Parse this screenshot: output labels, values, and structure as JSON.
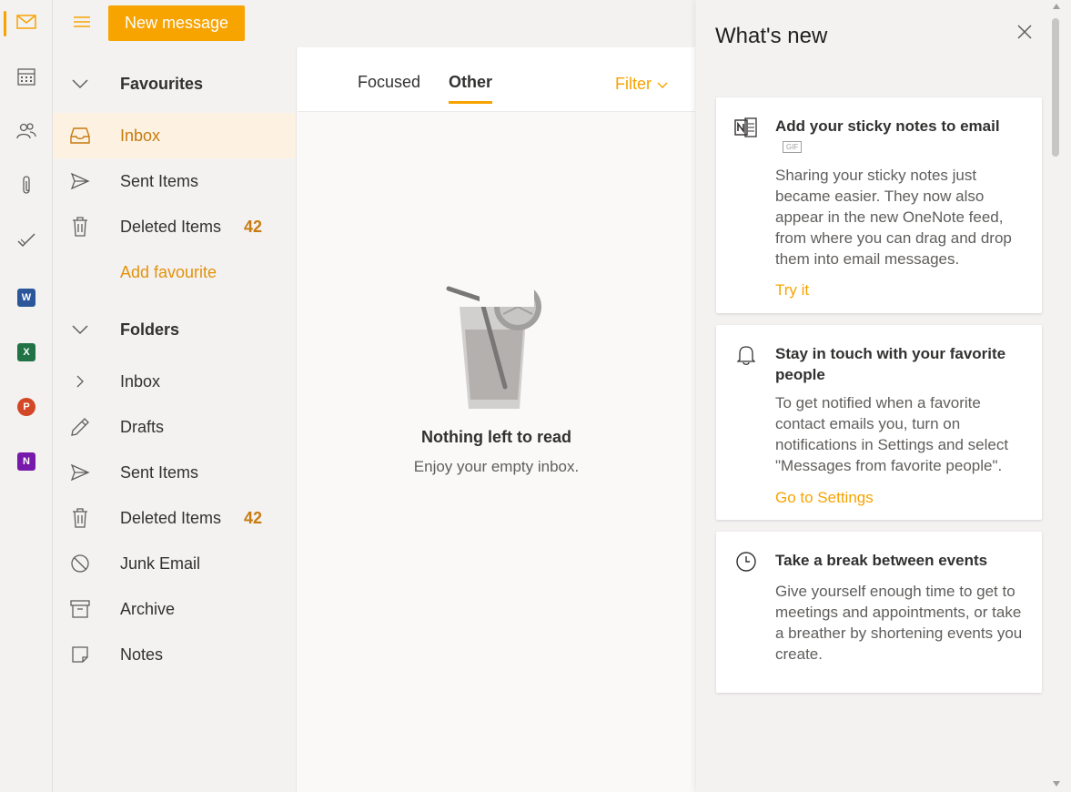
{
  "colors": {
    "accent": "#f7a300",
    "accent_text": "#c77b10",
    "selected_bg": "#fdf2e1"
  },
  "rail": {
    "items": [
      {
        "name": "mail-icon",
        "active": true
      },
      {
        "name": "calendar-icon"
      },
      {
        "name": "people-icon"
      },
      {
        "name": "paperclip-icon"
      },
      {
        "name": "todo-check-icon"
      },
      {
        "name": "word-icon",
        "letter": "W",
        "color": "#2b579a"
      },
      {
        "name": "excel-icon",
        "letter": "X",
        "color": "#217346"
      },
      {
        "name": "powerpoint-icon",
        "letter": "P",
        "color": "#d24726"
      },
      {
        "name": "onenote-icon",
        "letter": "N",
        "color": "#7719aa"
      }
    ]
  },
  "toolbar": {
    "new_message_label": "New message"
  },
  "favourites": {
    "title": "Favourites",
    "items": [
      {
        "label": "Inbox",
        "icon": "inbox-icon",
        "selected": true
      },
      {
        "label": "Sent Items",
        "icon": "send-icon"
      },
      {
        "label": "Deleted Items",
        "icon": "trash-icon",
        "count": "42"
      }
    ],
    "add_label": "Add favourite"
  },
  "folders": {
    "title": "Folders",
    "items": [
      {
        "label": "Inbox",
        "icon": "chevron-right-icon"
      },
      {
        "label": "Drafts",
        "icon": "pencil-icon"
      },
      {
        "label": "Sent Items",
        "icon": "send-icon"
      },
      {
        "label": "Deleted Items",
        "icon": "trash-icon",
        "count": "42"
      },
      {
        "label": "Junk Email",
        "icon": "block-icon"
      },
      {
        "label": "Archive",
        "icon": "archive-icon"
      },
      {
        "label": "Notes",
        "icon": "note-icon"
      }
    ]
  },
  "message_list": {
    "tabs": [
      {
        "label": "Focused"
      },
      {
        "label": "Other",
        "active": true
      }
    ],
    "filter_label": "Filter",
    "empty_title": "Nothing left to read",
    "empty_subtitle": "Enjoy your empty inbox."
  },
  "whats_new": {
    "title": "What's new",
    "cards": [
      {
        "icon": "onenote-sticky-icon",
        "title": "Add your sticky notes to email",
        "badge": "GIF",
        "body": "Sharing your sticky notes just became easier. They now also appear in the new OneNote feed, from where you can drag and drop them into email messages.",
        "link": "Try it"
      },
      {
        "icon": "bell-icon",
        "title": "Stay in touch with your favorite people",
        "body": "To get notified when a favorite contact emails you, turn on notifications in Settings and select \"Messages from favorite people\".",
        "link": "Go to Settings"
      },
      {
        "icon": "clock-icon",
        "title": "Take a break between events",
        "body": "Give yourself enough time to get to meetings and appointments, or take a breather by shortening events you create."
      }
    ]
  }
}
